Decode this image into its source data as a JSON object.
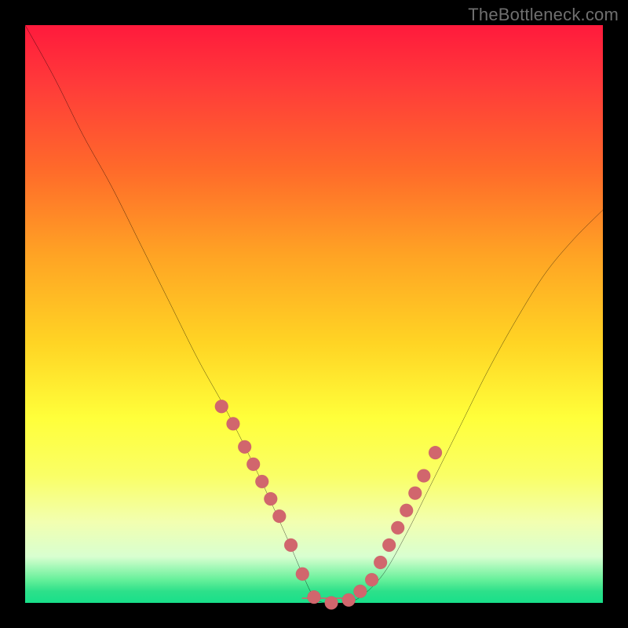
{
  "attribution": "TheBottleneck.com",
  "colors": {
    "background_frame": "#000000",
    "gradient_top": "#ff1a3c",
    "gradient_mid": "#ffd424",
    "gradient_bottom": "#18e08a",
    "curve": "#000000",
    "marker_fill": "#d1666d",
    "marker_stroke": "#b24e56"
  },
  "chart_data": {
    "type": "line",
    "title": "",
    "xlabel": "",
    "ylabel": "",
    "xlim": [
      0,
      100
    ],
    "ylim": [
      0,
      100
    ],
    "x": [
      0,
      5,
      10,
      15,
      20,
      25,
      30,
      35,
      40,
      45,
      48,
      50,
      52,
      55,
      58,
      62,
      66,
      70,
      75,
      80,
      85,
      90,
      95,
      100
    ],
    "values": [
      100,
      91,
      81,
      72,
      62,
      52,
      42,
      33,
      23,
      12,
      5,
      1,
      0,
      0,
      1,
      5,
      12,
      20,
      30,
      40,
      49,
      57,
      63,
      68
    ],
    "series": [
      {
        "name": "bottleneck-curve",
        "x": [
          0,
          5,
          10,
          15,
          20,
          25,
          30,
          35,
          40,
          45,
          48,
          50,
          52,
          55,
          58,
          62,
          66,
          70,
          75,
          80,
          85,
          90,
          95,
          100
        ],
        "values": [
          100,
          91,
          81,
          72,
          62,
          52,
          42,
          33,
          23,
          12,
          5,
          1,
          0,
          0,
          1,
          5,
          12,
          20,
          30,
          40,
          49,
          57,
          63,
          68
        ]
      }
    ],
    "markers": {
      "note": "highlighted sample points on the curve near the trough",
      "x": [
        34,
        36,
        38,
        39.5,
        41,
        42.5,
        44,
        46,
        48,
        50,
        53,
        56,
        58,
        60,
        61.5,
        63,
        64.5,
        66,
        67.5,
        69,
        71
      ],
      "y": [
        34,
        31,
        27,
        24,
        21,
        18,
        15,
        10,
        5,
        1,
        0,
        0.5,
        2,
        4,
        7,
        10,
        13,
        16,
        19,
        22,
        26
      ]
    }
  }
}
